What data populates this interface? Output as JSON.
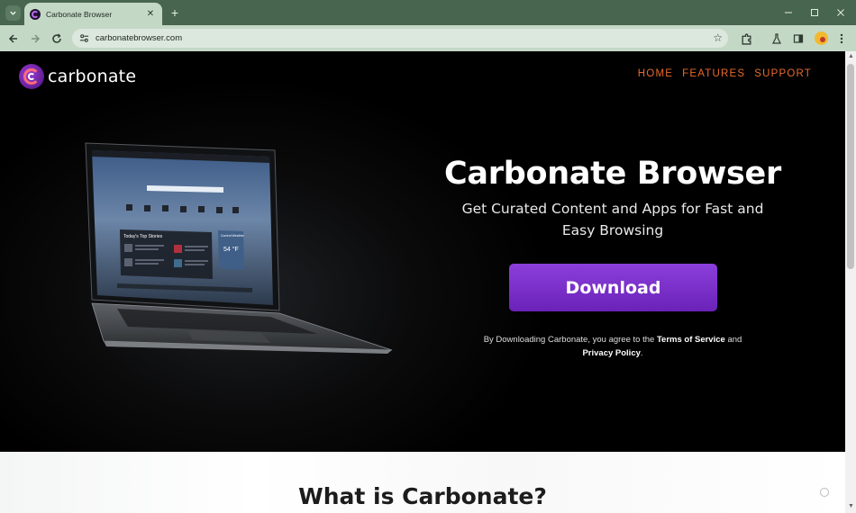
{
  "browser": {
    "tab_title": "Carbonate Browser",
    "url": "carbonatebrowser.com",
    "new_tab_glyph": "+",
    "close_glyph": "✕",
    "minimize_glyph": "—",
    "maximize_glyph": "☐",
    "window_close_glyph": "✕"
  },
  "site": {
    "logo_text": "carbonate",
    "nav": [
      "HOME",
      "FEATURES",
      "SUPPORT"
    ],
    "nav_color": "#e86a2a",
    "accent": "#7b2fd0"
  },
  "hero": {
    "title": "Carbonate Browser",
    "subtitle": "Get Curated Content and Apps for Fast and Easy Browsing",
    "download_label": "Download",
    "terms_prefix": "By Downloading Carbonate, you agree to the ",
    "terms_link": "Terms of Service",
    "terms_and": " and ",
    "privacy_link": "Privacy Policy",
    "terms_suffix": "."
  },
  "laptop_screen": {
    "section_title": "Today's Top Stories",
    "weather_label": "Current Weather",
    "temperature": "54 °F"
  },
  "below": {
    "title": "What is Carbonate?"
  }
}
